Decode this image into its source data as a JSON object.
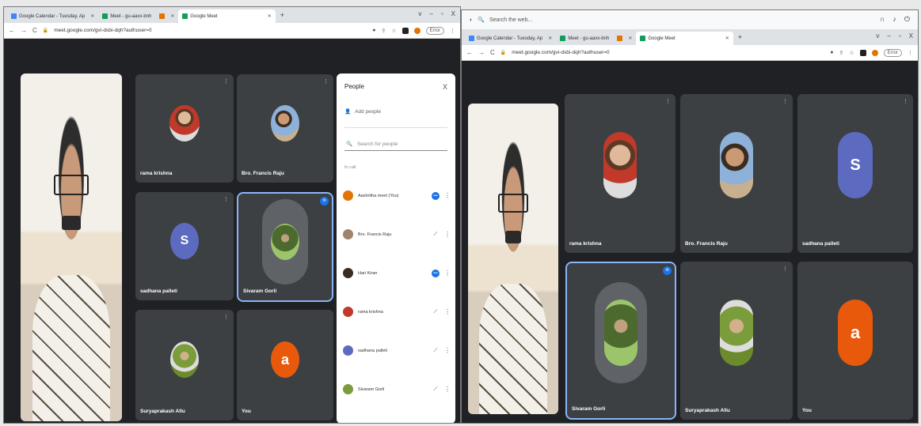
{
  "left": {
    "tabs": [
      {
        "label": "Google Calendar - Tuesday, Ap",
        "favicon": "#4285f4",
        "active": false
      },
      {
        "label": "Meet - gu-aaxx-bnh",
        "favicon": "#0f9d58",
        "active": false
      },
      {
        "label": "",
        "favicon": "#e37400",
        "active": false
      },
      {
        "label": "Google Meet",
        "favicon": "#0f9d58",
        "active": true
      }
    ],
    "new_tab": "+",
    "window_controls": [
      "v",
      "–",
      "▫",
      "X"
    ],
    "url": "meet.google.com/gvi-dsbi-dqh?authuser=0",
    "error_label": "Error",
    "self_name": "",
    "tiles": [
      {
        "name": "rama krishna",
        "avatar": "photo"
      },
      {
        "name": "Bro. Francis Raju",
        "avatar": "photo2"
      },
      {
        "name": "sadhana palleti",
        "letter": "S",
        "color": "#5c6bc0"
      },
      {
        "name": "Sivaram Gorli",
        "avatar": "photo3"
      },
      {
        "name": "Suryaprakash Allu",
        "avatar": "photo4"
      },
      {
        "name": "You",
        "letter": "a",
        "color": "#e8590c"
      }
    ],
    "people": {
      "title": "People",
      "add_people": "Add people",
      "search_placeholder": "Search for people",
      "section": "In call",
      "list": [
        {
          "name": "Aashritha meet (You)",
          "status": "active",
          "color": "#e37400"
        },
        {
          "name": "Bro. Francis Raju",
          "status": "muted",
          "color": "#a0826d"
        },
        {
          "name": "Hari Kiran",
          "status": "active",
          "color": "#3b2c22"
        },
        {
          "name": "rama krishna",
          "status": "muted",
          "color": "#c0392b"
        },
        {
          "name": "sadhana palleti",
          "status": "muted",
          "color": "#5c6bc0"
        },
        {
          "name": "Sivaram Gorli",
          "status": "muted",
          "color": "#7a9c3b"
        }
      ]
    }
  },
  "right": {
    "search_text": "Search the web...",
    "tabs": [
      {
        "label": "Google Calendar - Tuesday, Ap",
        "favicon": "#4285f4",
        "active": false
      },
      {
        "label": "Meet - gu-aaxx-bnh",
        "favicon": "#0f9d58",
        "active": false
      },
      {
        "label": "",
        "favicon": "#e37400",
        "active": false
      },
      {
        "label": "Google Meet",
        "favicon": "#0f9d58",
        "active": true
      }
    ],
    "new_tab": "+",
    "window_controls": [
      "v",
      "–",
      "▫",
      "X"
    ],
    "url": "meet.google.com/gvi-dsbi-dqh?authuser=0",
    "error_label": "Error",
    "tiles": [
      {
        "name": "rama krishna",
        "avatar": "photo"
      },
      {
        "name": "Bro. Francis Raju",
        "avatar": "photo2"
      },
      {
        "name": "sadhana palleti",
        "letter": "S",
        "color": "#5c6bc0"
      },
      {
        "name": "Sivaram Gorli",
        "avatar": "photo3"
      },
      {
        "name": "Suryaprakash Allu",
        "avatar": "photo4"
      },
      {
        "name": "You",
        "letter": "a",
        "color": "#e8590c"
      }
    ]
  },
  "icons": {
    "mic_off": "mic-off-icon",
    "speaking": "audio-wave-icon",
    "close": "close-icon",
    "add_person": "add-person-icon",
    "search": "search-icon",
    "more": "more-vert-icon"
  }
}
